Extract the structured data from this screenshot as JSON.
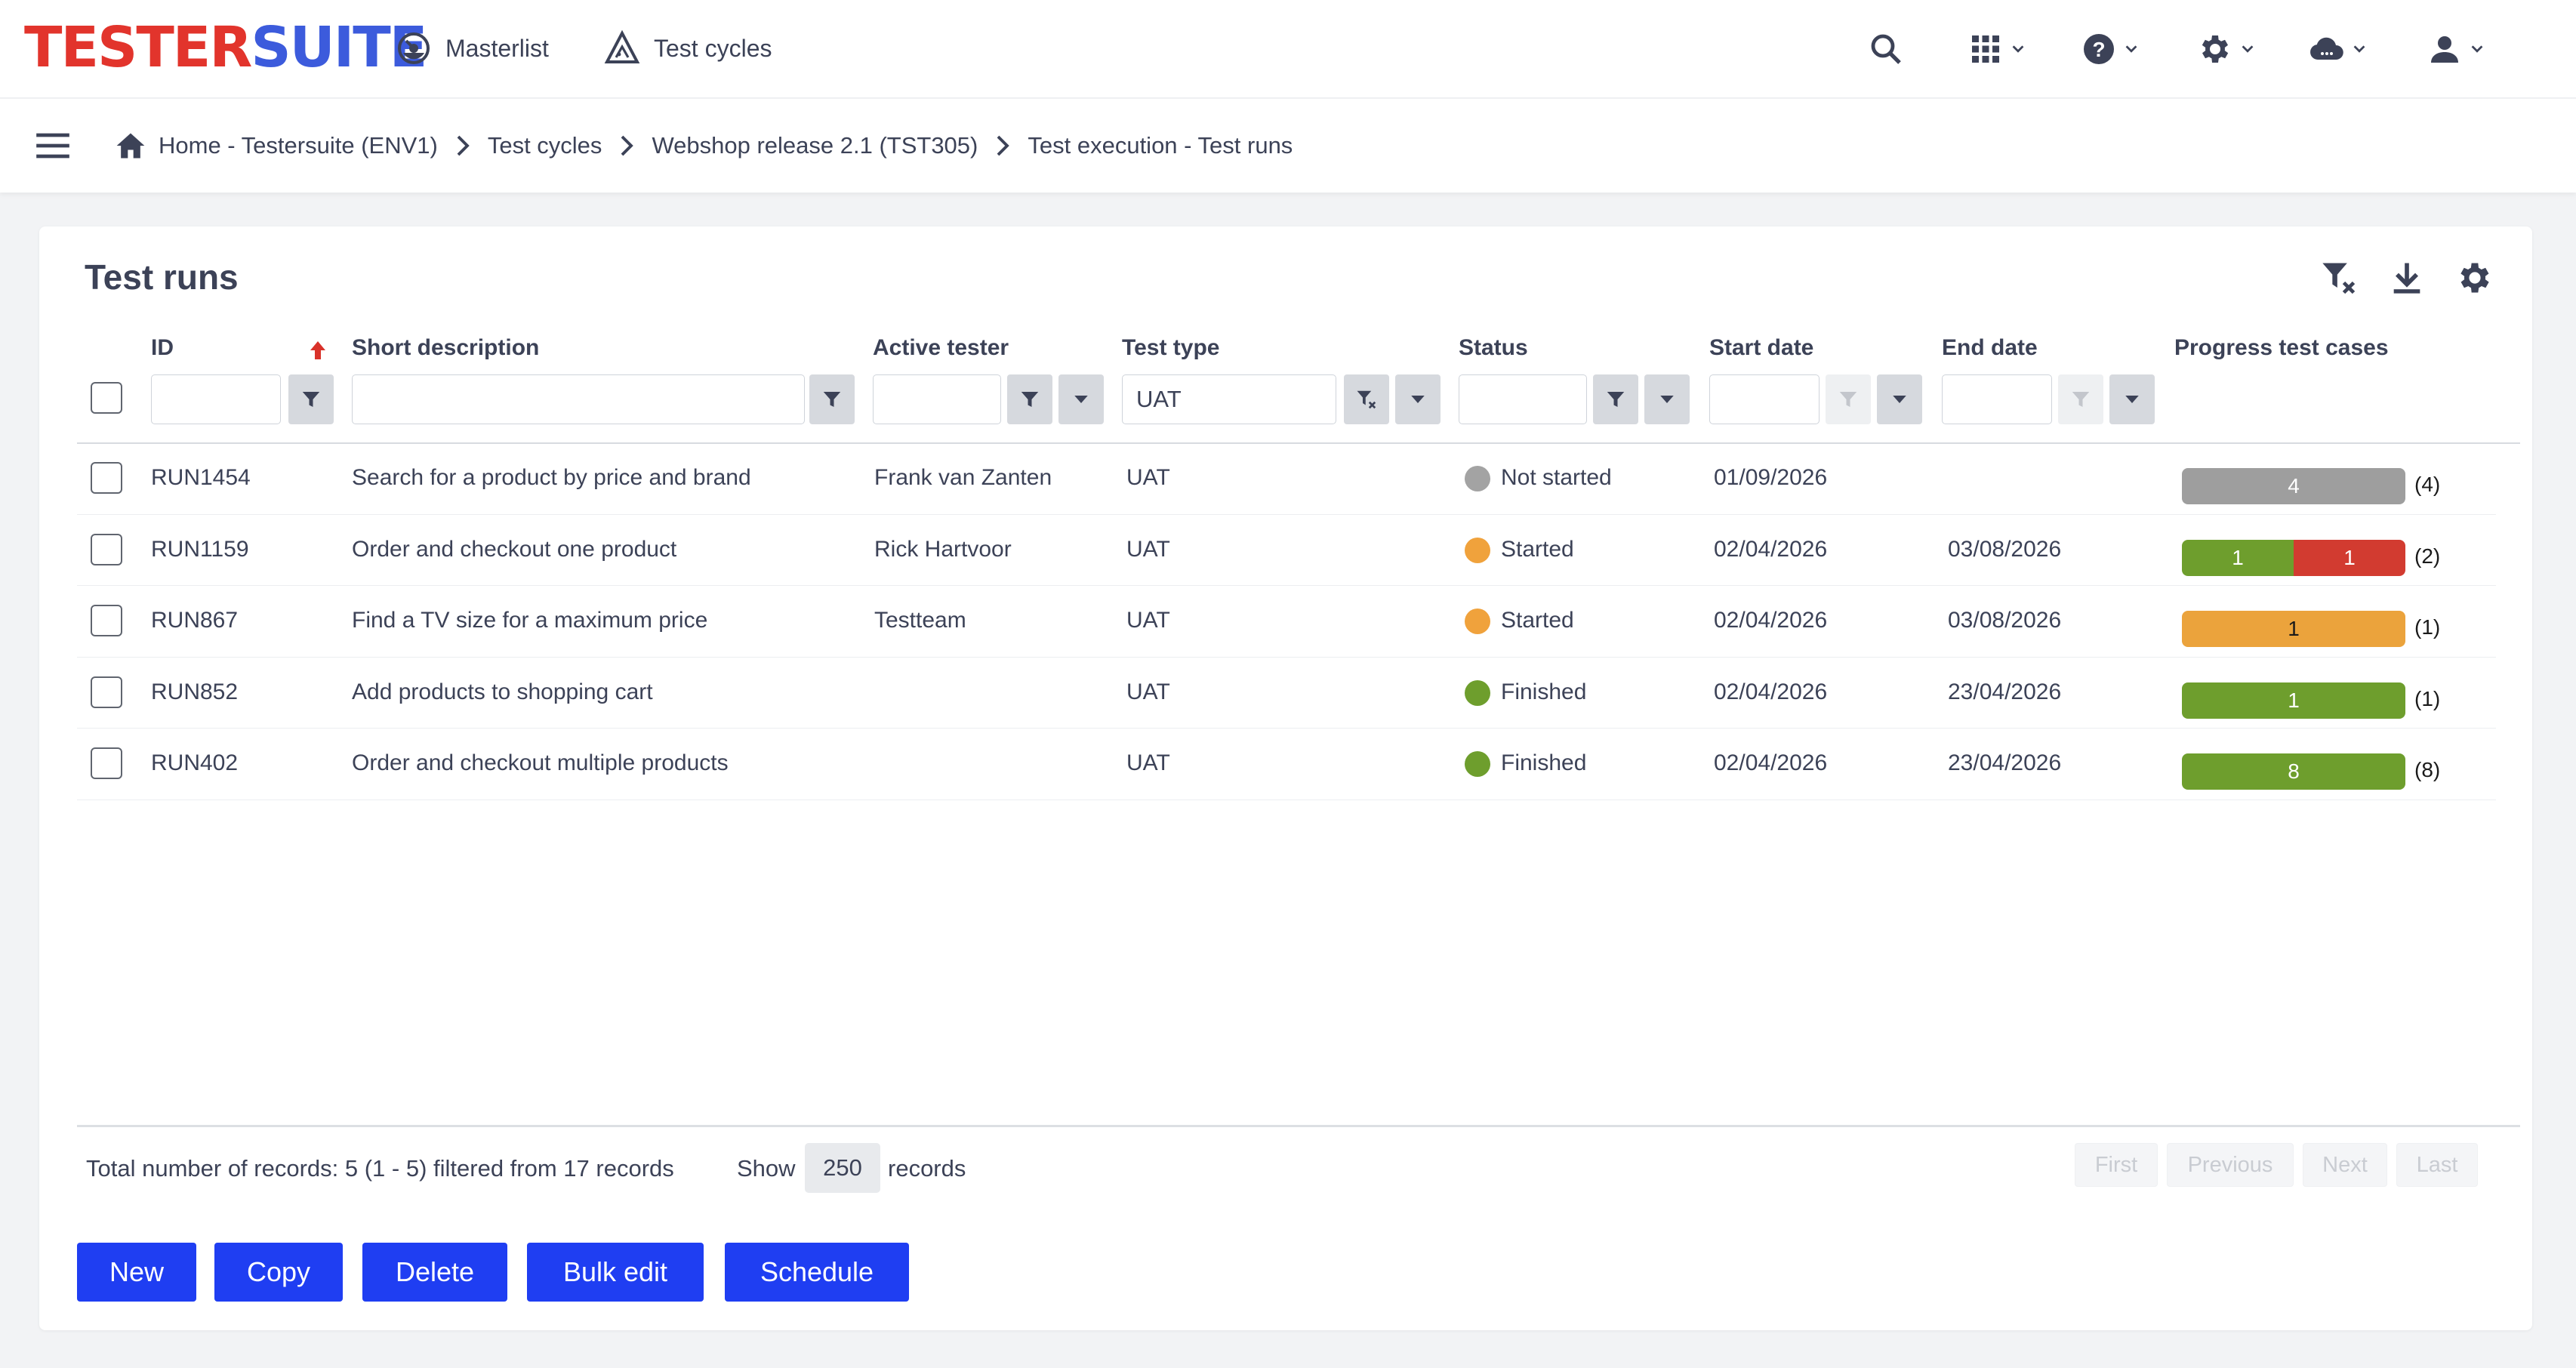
{
  "app": {
    "logo_part1": "TESTER",
    "logo_part2": "SUITE",
    "nav": [
      {
        "label": "Masterlist",
        "icon": "dashboard-icon"
      },
      {
        "label": "Test cycles",
        "icon": "test-cycles-icon"
      }
    ],
    "right_icons": [
      "search-icon",
      "apps-grid-icon",
      "help-icon",
      "gear-icon",
      "cloud-icon",
      "user-icon"
    ]
  },
  "breadcrumb": [
    "Home - Testersuite (ENV1)",
    "Test cycles",
    "Webshop release 2.1 (TST305)",
    "Test execution - Test runs"
  ],
  "page": {
    "title": "Test runs",
    "tools": [
      "clear-filter-icon",
      "download-icon",
      "settings-icon"
    ]
  },
  "table": {
    "columns": [
      "ID",
      "Short description",
      "Active tester",
      "Test type",
      "Status",
      "Start date",
      "End date",
      "Progress test cases"
    ],
    "filters": {
      "id": "",
      "short_description": "",
      "active_tester": "",
      "test_type": "UAT",
      "status": "",
      "start_date": "",
      "end_date": ""
    },
    "rows": [
      {
        "id": "RUN1454",
        "description": "Search for a product by price and brand",
        "tester": "Frank van Zanten",
        "type": "UAT",
        "status": "Not started",
        "status_color": "#a3a3a3",
        "start": "01/09/2026",
        "end": "",
        "progress": [
          {
            "label": "4",
            "value": 4,
            "color": "#9e9e9e"
          }
        ],
        "count": "(4)"
      },
      {
        "id": "RUN1159",
        "description": "Order and checkout one product",
        "tester": "Rick Hartvoor",
        "type": "UAT",
        "status": "Started",
        "status_color": "#f0a23c",
        "start": "02/04/2026",
        "end": "03/08/2026",
        "progress": [
          {
            "label": "1",
            "value": 1,
            "color": "#6e9e2d"
          },
          {
            "label": "1",
            "value": 1,
            "color": "#d23b30"
          }
        ],
        "count": "(2)"
      },
      {
        "id": "RUN867",
        "description": "Find a TV size for a maximum price",
        "tester": "Testteam",
        "type": "UAT",
        "status": "Started",
        "status_color": "#f0a23c",
        "start": "02/04/2026",
        "end": "03/08/2026",
        "progress": [
          {
            "label": "1",
            "value": 1,
            "color": "#eba33c"
          }
        ],
        "count": "(1)"
      },
      {
        "id": "RUN852",
        "description": "Add products to shopping cart",
        "tester": "",
        "type": "UAT",
        "status": "Finished",
        "status_color": "#6e9e2d",
        "start": "02/04/2026",
        "end": "23/04/2026",
        "progress": [
          {
            "label": "1",
            "value": 1,
            "color": "#6e9e2d"
          }
        ],
        "count": "(1)"
      },
      {
        "id": "RUN402",
        "description": "Order and checkout multiple products",
        "tester": "",
        "type": "UAT",
        "status": "Finished",
        "status_color": "#6e9e2d",
        "start": "02/04/2026",
        "end": "23/04/2026",
        "progress": [
          {
            "label": "8",
            "value": 8,
            "color": "#6e9e2d"
          }
        ],
        "count": "(8)"
      }
    ]
  },
  "footer": {
    "total": "Total number of records: 5 (1 - 5) filtered from 17 records",
    "show_label": "Show",
    "show_value": "250",
    "records_label": "records",
    "pager": [
      "First",
      "Previous",
      "Next",
      "Last"
    ]
  },
  "actions": [
    "New",
    "Copy",
    "Delete",
    "Bulk edit",
    "Schedule"
  ],
  "colors": {
    "accent": "#1f3ef2",
    "logo_red": "#e2342c",
    "logo_blue": "#3c5bdc",
    "sort_arrow": "#d9322a"
  }
}
